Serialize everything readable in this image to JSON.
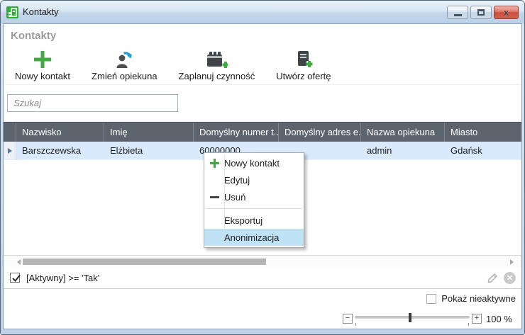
{
  "window": {
    "title": "Kontakty",
    "controls": {
      "minimize": "minimize-icon",
      "maximize": "maximize-icon",
      "close_glyph": "x"
    }
  },
  "panel": {
    "header": "Kontakty"
  },
  "toolbar": {
    "items": [
      {
        "label": "Nowy kontakt",
        "icon": "new-contact-plus-icon"
      },
      {
        "label": "Zmień opiekuna",
        "icon": "change-owner-icon"
      },
      {
        "label": "Zaplanuj czynność",
        "icon": "schedule-activity-icon"
      },
      {
        "label": "Utwórz ofertę",
        "icon": "create-offer-icon"
      }
    ]
  },
  "search": {
    "placeholder": "Szukaj",
    "value": ""
  },
  "table": {
    "columns": [
      "Nazwisko",
      "Imię",
      "Domyślny numer t...",
      "Domyślny adres e...",
      "Nazwa opiekuna",
      "Miasto"
    ],
    "rows": [
      {
        "selected": true,
        "cells": [
          "Barszczewska",
          "Elżbieta",
          "60000000",
          "",
          "admin",
          "Gdańsk"
        ]
      }
    ]
  },
  "context_menu": {
    "items": [
      {
        "label": "Nowy kontakt",
        "icon": "plus-icon"
      },
      {
        "label": "Edytuj",
        "icon": ""
      },
      {
        "label": "Usuń",
        "icon": "minus-icon"
      },
      {
        "label": "Eksportuj",
        "icon": ""
      },
      {
        "label": "Anonimizacja",
        "icon": "",
        "highlighted": true
      }
    ]
  },
  "filter_bar": {
    "checked": true,
    "expression": "[Aktywny] >= 'Tak'",
    "icons": [
      "edit-pencil-icon",
      "clear-filter-icon"
    ]
  },
  "footer": {
    "show_inactive": {
      "label": "Pokaż nieaktywne",
      "checked": false
    },
    "zoom": {
      "minus": "−",
      "plus": "+",
      "value": "100 %"
    }
  },
  "colors": {
    "grid_header_bg": "#5c646e",
    "selected_row_bg": "#d9eafc",
    "menu_highlight": "#bfe2f5",
    "accent_green": "#44a844",
    "accent_blue": "#1e9cd7",
    "close_button_red": "#d06351",
    "titlebar_blue": "#c9dbec"
  }
}
